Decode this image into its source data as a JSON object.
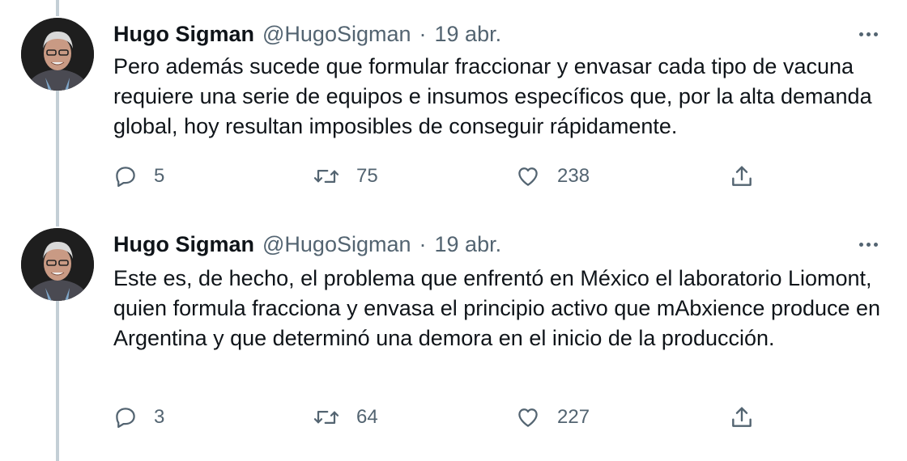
{
  "tweets": [
    {
      "author_name": "Hugo Sigman",
      "handle": "@HugoSigman",
      "separator": "·",
      "date": "19 abr.",
      "text": "Pero además sucede que formular fraccionar y envasar cada tipo de vacuna requiere una serie de equipos e insumos específicos que, por la alta demanda global, hoy resultan imposibles de conseguir rápidamente.",
      "replies": "5",
      "retweets": "75",
      "likes": "238"
    },
    {
      "author_name": "Hugo Sigman",
      "handle": "@HugoSigman",
      "separator": "·",
      "date": "19 abr.",
      "text": "Este es, de hecho, el problema que enfrentó en México el laboratorio Liomont, quien formula fracciona y envasa el principio activo que mAbxience produce en Argentina y que determinó una demora en el inicio de la producción.",
      "replies": "3",
      "retweets": "64",
      "likes": "227"
    }
  ],
  "icons": {
    "more": "more-horizontal-icon",
    "reply": "reply-icon",
    "retweet": "retweet-icon",
    "like": "like-icon",
    "share": "share-icon"
  },
  "colors": {
    "text": "#0f1419",
    "secondary": "#536471",
    "thread_line": "#c4cfd6"
  }
}
